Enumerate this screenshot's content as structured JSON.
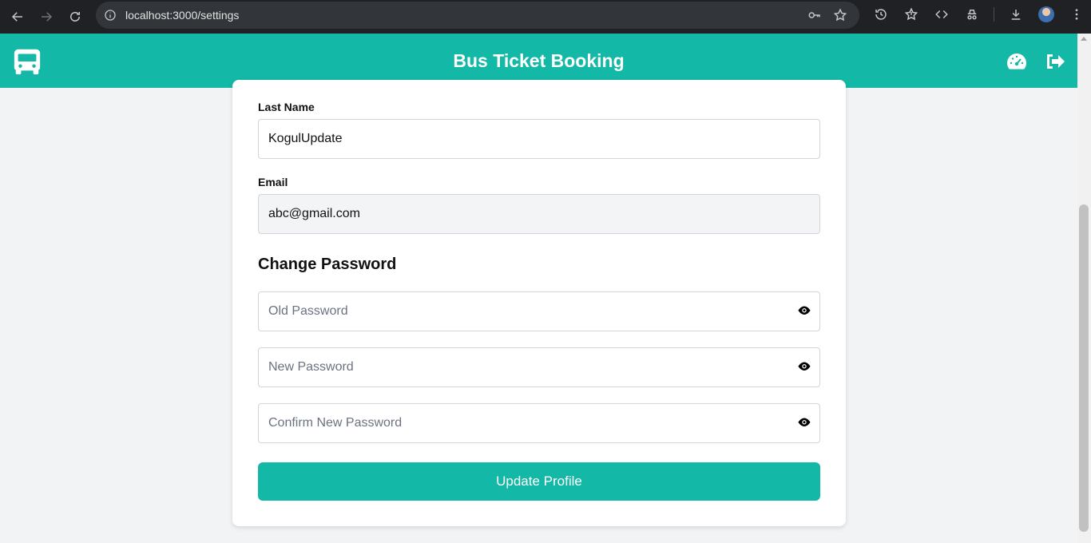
{
  "browser": {
    "url": "localhost:3000/settings",
    "icons": [
      "back-icon",
      "forward-icon",
      "reload-icon",
      "site-info-icon",
      "key-icon",
      "star-icon",
      "history-icon",
      "bookmarks-icon",
      "devtools-icon",
      "incognito-icon",
      "download-icon",
      "profile-avatar",
      "menu-icon"
    ]
  },
  "header": {
    "title": "Bus Ticket Booking",
    "brand_color": "#14b8a6",
    "icons": [
      "bus-icon",
      "dashboard-icon",
      "logout-icon"
    ]
  },
  "form": {
    "last_name_label": "Last Name",
    "last_name_value": "KogulUpdate",
    "email_label": "Email",
    "email_value": "abc@gmail.com",
    "change_password_title": "Change Password",
    "old_password_placeholder": "Old Password",
    "new_password_placeholder": "New Password",
    "confirm_password_placeholder": "Confirm New Password",
    "submit_label": "Update Profile"
  }
}
